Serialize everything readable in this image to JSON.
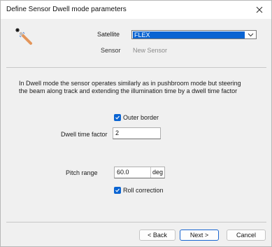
{
  "window": {
    "title": "Define Sensor Dwell mode parameters"
  },
  "icons": {
    "wand": "magic-wand-icon",
    "close": "close-icon",
    "dropdown": "chevron-down-icon",
    "check": "check-icon"
  },
  "colors": {
    "accent": "#0a64d2",
    "background": "#f0f0f0"
  },
  "form": {
    "satellite_label": "Satellite",
    "satellite_value": "FLEX",
    "sensor_label": "Sensor",
    "sensor_value": "New Sensor"
  },
  "description": "In Dwell mode the sensor operates similarly as in pushbroom mode but steering the beam along track and extending the illumination time by a dwell time factor",
  "outer_border": {
    "label": "Outer border",
    "checked": true
  },
  "dwell_time": {
    "label": "Dwell time factor",
    "value": "2"
  },
  "pitch_range": {
    "label": "Pitch range",
    "value": "60.0",
    "unit": "deg"
  },
  "roll_correction": {
    "label": "Roll correction",
    "checked": true
  },
  "buttons": {
    "back": "< Back",
    "next": "Next >",
    "cancel": "Cancel"
  }
}
